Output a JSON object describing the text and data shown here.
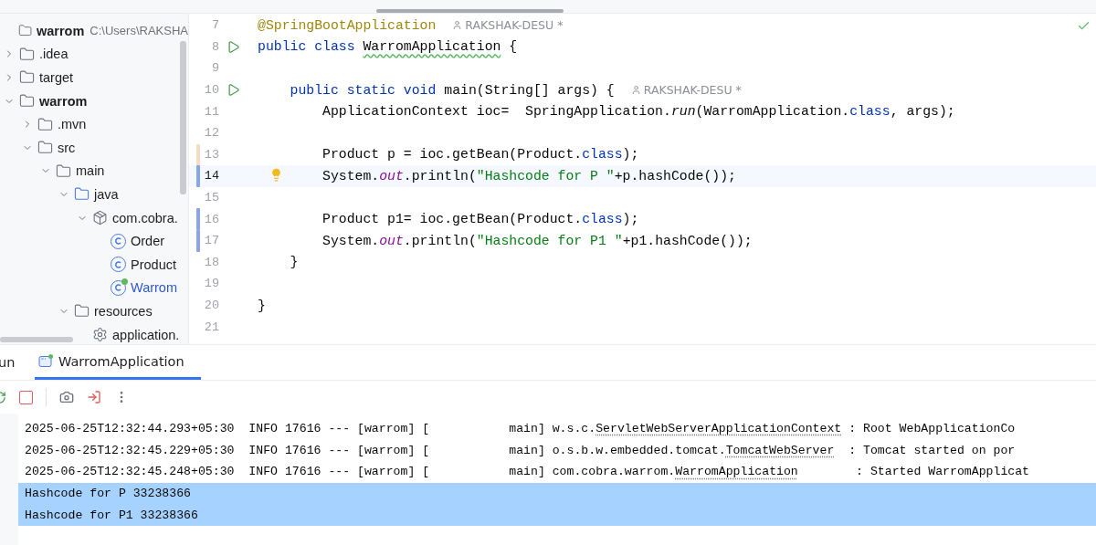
{
  "project_tree": [
    {
      "label": "warrom",
      "kind": "module",
      "path": "C:\\Users\\RAKSHA"
    },
    {
      "label": ".idea",
      "kind": "folder",
      "expanded": false
    },
    {
      "label": "target",
      "kind": "folder",
      "expanded": false
    },
    {
      "label": "warrom",
      "kind": "module",
      "expanded": true,
      "children": [
        {
          "label": ".mvn",
          "kind": "folder",
          "expanded": false
        },
        {
          "label": "src",
          "kind": "folder",
          "expanded": true,
          "children": [
            {
              "label": "main",
              "kind": "folder",
              "expanded": true,
              "children": [
                {
                  "label": "java",
                  "kind": "source",
                  "expanded": true,
                  "children": [
                    {
                      "label": "com.cobra.",
                      "kind": "package",
                      "expanded": true,
                      "children": [
                        {
                          "label": "Order",
                          "kind": "class",
                          "selected": false
                        },
                        {
                          "label": "Product",
                          "kind": "class",
                          "selected": false
                        },
                        {
                          "label": "Warrom",
                          "kind": "main-class",
                          "selected": true
                        }
                      ]
                    }
                  ]
                },
                {
                  "label": "resources",
                  "kind": "resources",
                  "expanded": true,
                  "children": [
                    {
                      "label": "application.",
                      "kind": "config"
                    }
                  ]
                }
              ]
            }
          ]
        }
      ]
    }
  ],
  "editor": {
    "lines": [
      {
        "number": "7",
        "run": false,
        "current": false,
        "bulb": false,
        "tokens": [
          {
            "text": "@SpringBootApplication",
            "kind": "annotation"
          }
        ],
        "author": "RAKSHAK-DESU *"
      },
      {
        "number": "8",
        "run": true,
        "current": false,
        "bulb": false,
        "tokens": [
          {
            "text": "public class ",
            "kind": "keyword"
          },
          {
            "text": "WarromApplication",
            "kind": "typo"
          },
          {
            "text": " {",
            "kind": "plain"
          }
        ]
      },
      {
        "number": "9",
        "run": false,
        "current": false,
        "bulb": false
      },
      {
        "number": "10",
        "run": true,
        "current": false,
        "bulb": false,
        "tokens": [
          {
            "text": "    public static void ",
            "kind": "keyword"
          },
          {
            "text": "main(String[] args) {",
            "kind": "plain"
          }
        ],
        "author": "RAKSHAK-DESU *"
      },
      {
        "number": "11",
        "run": false,
        "current": false,
        "bulb": false,
        "tokens": [
          {
            "text": "        ApplicationContext ioc=  SpringApplication.",
            "kind": "plain"
          },
          {
            "text": "run",
            "kind": "static"
          },
          {
            "text": "(WarromApplication.",
            "kind": "plain"
          },
          {
            "text": "class",
            "kind": "keyword"
          },
          {
            "text": ", args);",
            "kind": "plain"
          }
        ]
      },
      {
        "number": "12",
        "run": false,
        "current": false,
        "bulb": false
      },
      {
        "number": "13",
        "run": false,
        "current": false,
        "bulb": false,
        "change": {
          "color": "#f5dcc4"
        },
        "tokens": [
          {
            "text": "        Product p = ioc.getBean(Product.",
            "kind": "plain"
          },
          {
            "text": "class",
            "kind": "keyword"
          },
          {
            "text": ");",
            "kind": "plain"
          }
        ]
      },
      {
        "number": "14",
        "run": false,
        "current": true,
        "bulb": true,
        "change": {
          "color": "#8aa6ea"
        },
        "tokens": [
          {
            "text": "        System.",
            "kind": "plain"
          },
          {
            "text": "out",
            "kind": "field"
          },
          {
            "text": ".println(",
            "kind": "plain"
          },
          {
            "text": "\"Hashcode for P \"",
            "kind": "string"
          },
          {
            "text": "+p.hashCode());",
            "kind": "plain"
          }
        ]
      },
      {
        "number": "15",
        "run": false,
        "current": false,
        "bulb": false
      },
      {
        "number": "16",
        "run": false,
        "current": false,
        "bulb": false,
        "change": {
          "color": "#8aa6ea"
        },
        "tokens": [
          {
            "text": "        Product p1= ioc.getBean(Product.",
            "kind": "plain"
          },
          {
            "text": "class",
            "kind": "keyword"
          },
          {
            "text": ");",
            "kind": "plain"
          }
        ]
      },
      {
        "number": "17",
        "run": false,
        "current": false,
        "bulb": false,
        "change": {
          "color": "#8aa6ea"
        },
        "tokens": [
          {
            "text": "        System.",
            "kind": "plain"
          },
          {
            "text": "out",
            "kind": "field"
          },
          {
            "text": ".println(",
            "kind": "plain"
          },
          {
            "text": "\"Hashcode for P1 \"",
            "kind": "string"
          },
          {
            "text": "+p1.hashCode());",
            "kind": "plain"
          }
        ]
      },
      {
        "number": "18",
        "run": false,
        "current": false,
        "bulb": false,
        "tokens": [
          {
            "text": "    }",
            "kind": "plain"
          }
        ]
      },
      {
        "number": "19",
        "run": false,
        "current": false,
        "bulb": false
      },
      {
        "number": "20",
        "run": false,
        "current": false,
        "bulb": false,
        "tokens": [
          {
            "text": "}",
            "kind": "plain"
          }
        ]
      },
      {
        "number": "21",
        "run": false,
        "current": false,
        "bulb": false
      }
    ]
  },
  "run_panel": {
    "title": "un",
    "tabs": [
      {
        "label": "WarromApplication",
        "selected": true
      }
    ],
    "console": [
      {
        "text": "2025-06-25T12:32:44.293+05:30  INFO 17616 --- [warrom] [           main] w.s.c.",
        "link": "ServletWebServerApplicationContext",
        "rest": " : Root WebApplicationCo",
        "selected": false
      },
      {
        "text": "2025-06-25T12:32:45.229+05:30  INFO 17616 --- [warrom] [           main] o.s.b.w.embedded.tomcat.",
        "link": "TomcatWebServer",
        "rest": "  : Tomcat started on por",
        "selected": false
      },
      {
        "text": "2025-06-25T12:32:45.248+05:30  INFO 17616 --- [warrom] [           main] com.cobra.warrom.",
        "link": "WarromApplication",
        "rest": "        : Started WarromApplicat",
        "selected": false
      },
      {
        "text": "Hashcode for P 33238366",
        "selected": true
      },
      {
        "text": "Hashcode for P1 33238366",
        "selected": true
      }
    ]
  }
}
